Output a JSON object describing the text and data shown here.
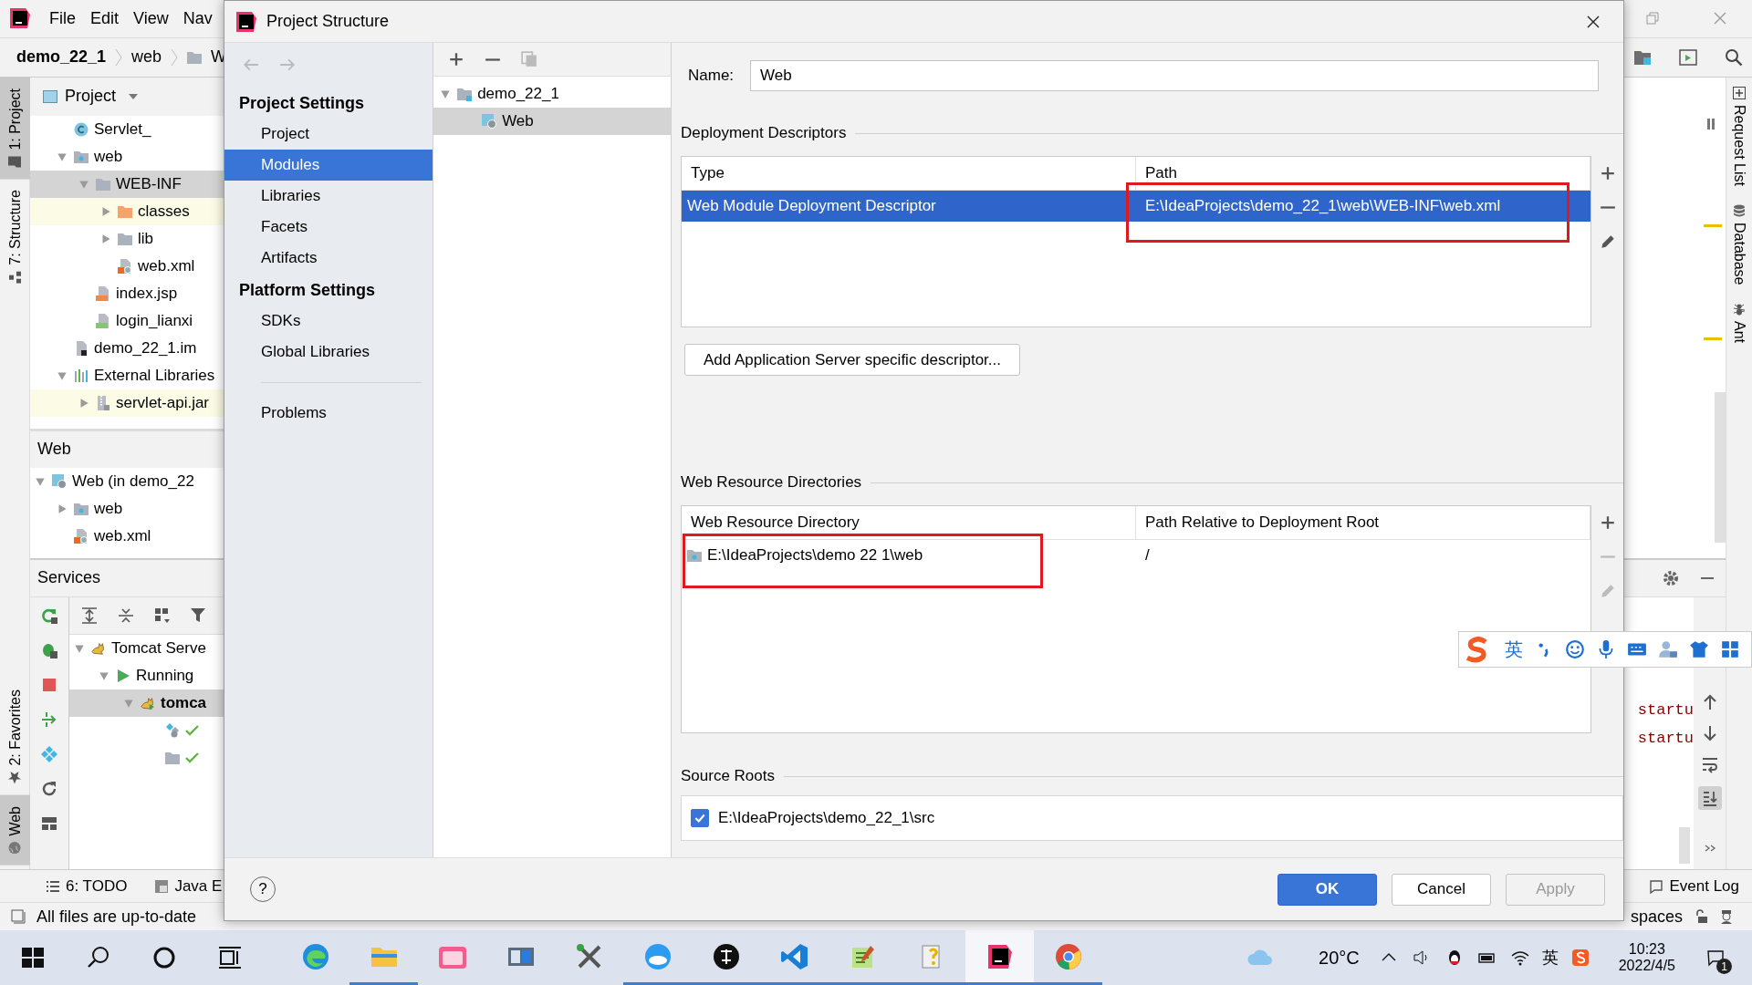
{
  "menu_bar": {
    "items": [
      "File",
      "Edit",
      "View",
      "Nav"
    ]
  },
  "breadcrumbs": [
    "demo_22_1",
    "web",
    "W"
  ],
  "left_stripe_top": [
    {
      "label": "1: Project",
      "kind": "project",
      "selected": true
    },
    {
      "label": "7: Structure",
      "kind": "structure",
      "selected": false
    }
  ],
  "left_stripe_bottom": [
    {
      "label": "2: Favorites",
      "kind": "favorites",
      "selected": false
    },
    {
      "label": "Web",
      "kind": "web",
      "selected": true
    }
  ],
  "project_panel": {
    "title": "Project",
    "tree": [
      {
        "label": "Servlet_",
        "kind": "class",
        "selected": false
      },
      {
        "label": "web",
        "kind": "web-folder",
        "expanded": true,
        "selected": false,
        "children": [
          {
            "label": "WEB-INF",
            "kind": "folder",
            "expanded": true,
            "selected": true,
            "children": [
              {
                "label": "classes",
                "kind": "excluded-folder",
                "expanded": false,
                "selected": false,
                "highlighted": true
              },
              {
                "label": "lib",
                "kind": "folder",
                "expanded": false,
                "selected": false
              },
              {
                "label": "web.xml",
                "kind": "xml",
                "selected": false
              }
            ]
          },
          {
            "label": "index.jsp",
            "kind": "jsp",
            "selected": false
          },
          {
            "label": "login_lianxi",
            "kind": "html",
            "selected": false
          }
        ]
      },
      {
        "label": "demo_22_1.im",
        "kind": "iml",
        "selected": false
      },
      {
        "label": "External Libraries",
        "kind": "libraries",
        "expanded": true,
        "selected": false,
        "children": [
          {
            "label": "servlet-api.jar",
            "kind": "jar",
            "expanded": false,
            "selected": false,
            "highlighted": true
          }
        ]
      }
    ]
  },
  "web_panel": {
    "title": "Web",
    "tree": [
      {
        "label": "Web (in demo_22",
        "kind": "web-facet",
        "expanded": true,
        "selected": false,
        "children": [
          {
            "label": "web",
            "kind": "web-folder",
            "expanded": false,
            "selected": false
          },
          {
            "label": "web.xml",
            "kind": "xml",
            "selected": false
          }
        ]
      }
    ]
  },
  "services_panel": {
    "title": "Services",
    "tree": [
      {
        "label": "Tomcat Serve",
        "kind": "tomcat",
        "expanded": true,
        "selected": false,
        "children": [
          {
            "label": "Running",
            "kind": "running",
            "expanded": true,
            "selected": false,
            "children": [
              {
                "label": "tomca",
                "kind": "tomcat-run",
                "expanded": true,
                "selected": true,
                "children": [
                  {
                    "kind": "artifact-ok",
                    "selected": false
                  },
                  {
                    "kind": "folder-ok",
                    "selected": false
                  }
                ]
              }
            ]
          }
        ]
      }
    ],
    "console_lines": [
      "startu",
      "startu"
    ]
  },
  "right_stripe": [
    {
      "label": "Request List",
      "kind": "request"
    },
    {
      "label": "Database",
      "kind": "database"
    },
    {
      "label": "Ant",
      "kind": "ant"
    }
  ],
  "bottom_tool_bar": {
    "tabs": [
      "6: TODO",
      "Java E"
    ],
    "event_log": "Event Log"
  },
  "status_bar": {
    "message": "All files are up-to-date",
    "indent": "spaces"
  },
  "dialog": {
    "title": "Project Structure",
    "nav": [
      {
        "kind": "back",
        "disabled": true
      },
      {
        "kind": "forward",
        "disabled": true
      }
    ],
    "sidebar": [
      {
        "heading": "Project Settings",
        "items": [
          {
            "label": "Project",
            "selected": false
          },
          {
            "label": "Modules",
            "selected": true
          },
          {
            "label": "Libraries",
            "selected": false
          },
          {
            "label": "Facets",
            "selected": false
          },
          {
            "label": "Artifacts",
            "selected": false
          }
        ]
      },
      {
        "heading": "Platform Settings",
        "items": [
          {
            "label": "SDKs",
            "selected": false
          },
          {
            "label": "Global Libraries",
            "selected": false
          }
        ]
      },
      {
        "items": [
          {
            "label": "Problems",
            "selected": false
          }
        ]
      }
    ],
    "tree_tools": [
      {
        "kind": "add",
        "disabled": false
      },
      {
        "kind": "remove",
        "disabled": false
      },
      {
        "kind": "copy",
        "disabled": true
      }
    ],
    "modules_tree": [
      {
        "label": "demo_22_1",
        "kind": "module",
        "expanded": true,
        "selected": false,
        "children": [
          {
            "label": "Web",
            "kind": "web-facet",
            "selected": true
          }
        ]
      }
    ],
    "name": {
      "label": "Name:",
      "value": "Web"
    },
    "deployment_descriptors": {
      "title": "Deployment Descriptors",
      "columns": [
        "Type",
        "Path"
      ],
      "rows": [
        {
          "selected": true,
          "cells": [
            {
              "text": "Web Module Deployment Descriptor",
              "marked": false
            },
            {
              "text": "E:\\IdeaProjects\\demo_22_1\\web\\WEB-INF\\web.xml",
              "marked": true
            }
          ]
        }
      ],
      "tools": [
        {
          "kind": "add",
          "disabled": false
        },
        {
          "kind": "remove",
          "disabled": false
        },
        {
          "kind": "edit",
          "disabled": false
        }
      ],
      "add_button": "Add Application Server specific descriptor..."
    },
    "web_resource_directories": {
      "title": "Web Resource Directories",
      "columns": [
        "Web Resource Directory",
        "Path Relative to Deployment Root"
      ],
      "rows": [
        {
          "selected": false,
          "cells": [
            {
              "text": "E:\\IdeaProjects\\demo 22 1\\web",
              "marked": true,
              "kind": "directory"
            },
            {
              "text": "/",
              "marked": false
            }
          ]
        }
      ],
      "tools": [
        {
          "kind": "add",
          "disabled": false
        },
        {
          "kind": "remove",
          "disabled": true
        },
        {
          "kind": "edit",
          "disabled": true
        }
      ]
    },
    "source_roots": {
      "title": "Source Roots",
      "items": [
        {
          "label": "E:\\IdeaProjects\\demo_22_1\\src",
          "checked": true
        }
      ]
    },
    "help": "?",
    "buttons": [
      {
        "label": "OK",
        "kind": "primary",
        "disabled": false
      },
      {
        "label": "Cancel",
        "kind": "normal",
        "disabled": false
      },
      {
        "label": "Apply",
        "kind": "normal",
        "disabled": true
      }
    ]
  },
  "ime_toolbar": {
    "mode": "英"
  },
  "taskbar": {
    "apps": [
      {
        "kind": "edge",
        "running": false,
        "selected": false
      },
      {
        "kind": "explorer",
        "running": true,
        "selected": false
      },
      {
        "kind": "bilibili",
        "running": false,
        "selected": false
      },
      {
        "kind": "window",
        "running": false,
        "selected": false
      },
      {
        "kind": "tools",
        "running": false,
        "selected": false
      },
      {
        "kind": "browser",
        "running": true,
        "selected": false
      },
      {
        "kind": "dark-circle",
        "running": true,
        "selected": false
      },
      {
        "kind": "vscode",
        "running": true,
        "selected": false
      },
      {
        "kind": "editor",
        "running": true,
        "selected": false
      },
      {
        "kind": "help-file",
        "running": true,
        "selected": false
      },
      {
        "kind": "intellij",
        "running": true,
        "selected": true
      },
      {
        "kind": "chrome",
        "running": true,
        "selected": false
      }
    ],
    "weather": "20°C",
    "tray_ime": "英",
    "time": "10:23",
    "date": "2022/4/5",
    "notifications": "1"
  }
}
